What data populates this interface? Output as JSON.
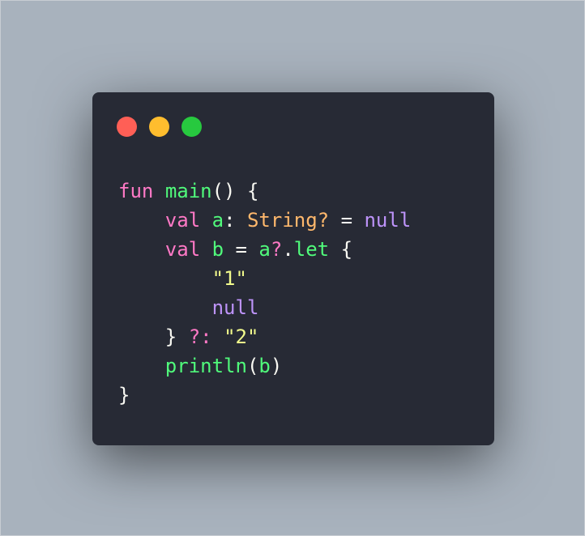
{
  "window_controls": {
    "close": "#ff5f56",
    "minimize": "#ffbd2e",
    "maximize": "#27c93f"
  },
  "code": {
    "language": "kotlin",
    "lines": [
      [
        [
          "kw",
          "fun"
        ],
        [
          "pl",
          " "
        ],
        [
          "fn",
          "main"
        ],
        [
          "pl",
          "() {"
        ]
      ],
      [
        [
          "pl",
          "    "
        ],
        [
          "kw",
          "val"
        ],
        [
          "pl",
          " "
        ],
        [
          "fn",
          "a"
        ],
        [
          "pl",
          ": "
        ],
        [
          "ty",
          "String?"
        ],
        [
          "pl",
          " = "
        ],
        [
          "nl",
          "null"
        ]
      ],
      [
        [
          "pl",
          "    "
        ],
        [
          "kw",
          "val"
        ],
        [
          "pl",
          " "
        ],
        [
          "fn",
          "b"
        ],
        [
          "pl",
          " = "
        ],
        [
          "fn",
          "a"
        ],
        [
          "op",
          "?"
        ],
        [
          "pl",
          "."
        ],
        [
          "fn",
          "let"
        ],
        [
          "pl",
          " {"
        ]
      ],
      [
        [
          "pl",
          "        "
        ],
        [
          "str",
          "\"1\""
        ]
      ],
      [
        [
          "pl",
          "        "
        ],
        [
          "nl",
          "null"
        ]
      ],
      [
        [
          "pl",
          "    } "
        ],
        [
          "op",
          "?:"
        ],
        [
          "pl",
          " "
        ],
        [
          "str",
          "\"2\""
        ]
      ],
      [
        [
          "pl",
          "    "
        ],
        [
          "fn",
          "println"
        ],
        [
          "pl",
          "("
        ],
        [
          "fn",
          "b"
        ],
        [
          "pl",
          ")"
        ]
      ],
      [
        [
          "pl",
          "}"
        ]
      ]
    ]
  }
}
